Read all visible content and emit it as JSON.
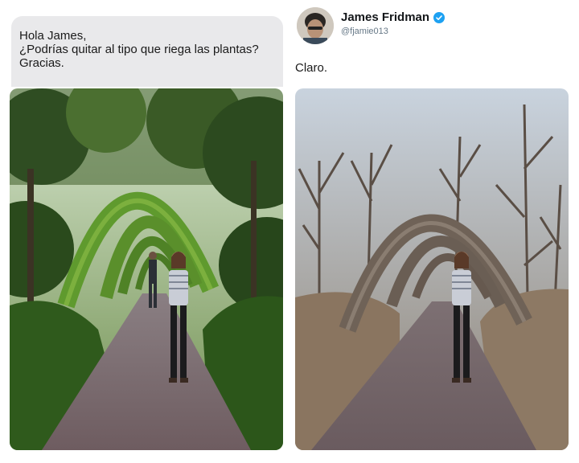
{
  "request": {
    "lines": [
      "Hola James,",
      "¿Podrías quitar al tipo que riega las plantas?",
      "Gracias."
    ]
  },
  "reply": {
    "author_name": "James Fridman",
    "handle": "@fjamie013",
    "verified": true,
    "text": "Claro.",
    "verified_color": "#1da1f2"
  },
  "photos": {
    "before": "green-garden-arch-walkway-with-waterer",
    "after": "dry-bare-tree-arch-walkway"
  },
  "colors": {
    "bubble": "#e9e9eb",
    "text": "#1a1a1a",
    "handle": "#657786"
  }
}
